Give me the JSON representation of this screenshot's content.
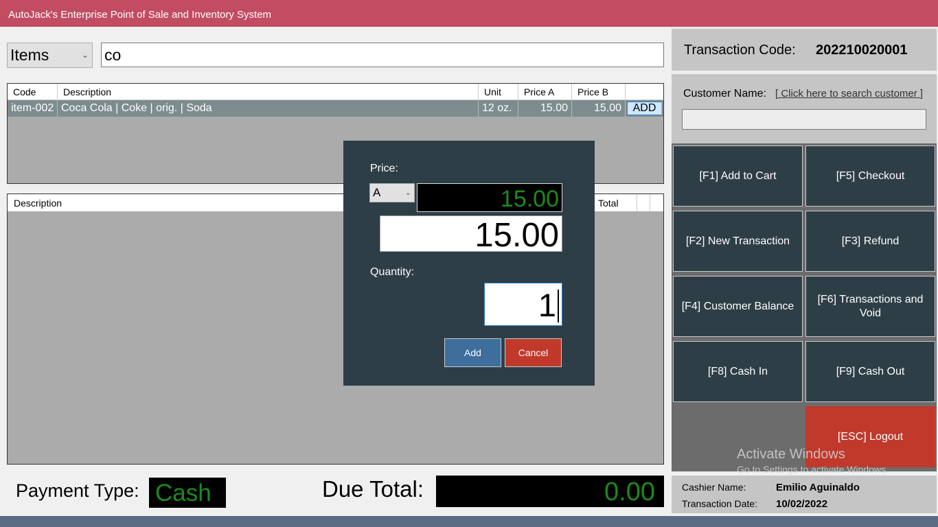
{
  "window": {
    "title": "AutoJack's Enterprise Point of Sale and Inventory System"
  },
  "search": {
    "type": "Items",
    "query": "co"
  },
  "items_table": {
    "columns": [
      "Code",
      "Description",
      "Unit",
      "Price A",
      "Price B"
    ],
    "rows": [
      {
        "code": "item-002",
        "description": "Coca Cola | Coke | orig. | Soda",
        "unit": "12 oz.",
        "price_a": "15.00",
        "price_b": "15.00",
        "action": "ADD"
      }
    ]
  },
  "cart_table": {
    "columns": {
      "description": "Description",
      "total": "Total"
    }
  },
  "payment": {
    "label": "Payment Type:",
    "value": "Cash"
  },
  "due": {
    "label": "Due Total:",
    "value": "0.00"
  },
  "transaction": {
    "label": "Transaction Code:",
    "code": "202210020001"
  },
  "customer": {
    "label": "Customer Name:",
    "search_link": "[ Click here to search customer ]",
    "value": ""
  },
  "functions": {
    "f1": "[F1] Add to Cart",
    "f5": "[F5] Checkout",
    "f2": "[F2] New Transaction",
    "f3": "[F3] Refund",
    "f4": "[F4] Customer Balance",
    "f6": "[F6] Transactions and Void",
    "f8": "[F8] Cash In",
    "f9": "[F9] Cash Out",
    "esc": "[ESC] Logout"
  },
  "cashier": {
    "name_label": "Cashier Name:",
    "name": "Emilio Aguinaldo",
    "date_label": "Transaction Date:",
    "date": "10/02/2022"
  },
  "watermark": {
    "line1": "Activate Windows",
    "line2": "Go to Settings to activate Windows."
  },
  "modal": {
    "price_label": "Price:",
    "price_option": "A",
    "price_display": "15.00",
    "price_value": "15.00",
    "quantity_label": "Quantity:",
    "quantity_value": "1",
    "add_label": "Add",
    "cancel_label": "Cancel"
  },
  "colors": {
    "titlebar": "#c24c62",
    "panel": "#2e3e47",
    "accent_green": "#1c8a1c",
    "danger": "#c0392b",
    "primary": "#3d6e9c"
  }
}
